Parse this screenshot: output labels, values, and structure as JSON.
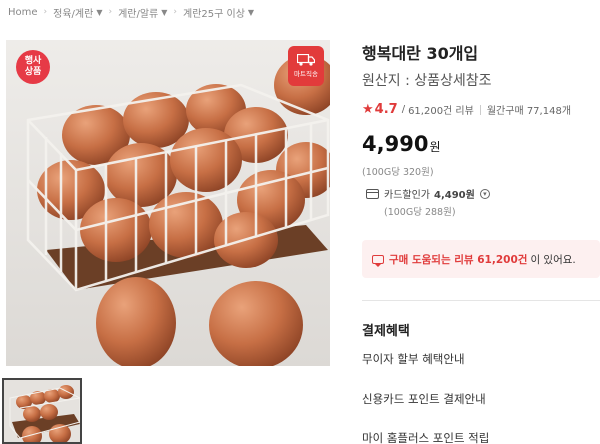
{
  "breadcrumb": {
    "home": "Home",
    "items": [
      "정육/계란",
      "계란/알류",
      "계란25구 이상"
    ]
  },
  "badges": {
    "event_line1": "행사",
    "event_line2": "상품",
    "mart_label": "마트직송"
  },
  "product": {
    "title": "행복대란 30개입",
    "origin": "원산지 : 상품상세참조",
    "rating": "4.7",
    "reviews": "61,200건 리뷰",
    "monthly": "월간구매 77,148개",
    "price": "4,990",
    "price_unit": "원",
    "unit_price": "(100G당 320원)",
    "card_label": "카드할인가",
    "card_price": "4,490원",
    "card_unit_price": "(100G당 288원)"
  },
  "review_banner": {
    "highlight": "구매 도움되는 리뷰 61,200건",
    "suffix": "이 있어요."
  },
  "benefits": {
    "title": "결제혜택",
    "items": [
      "무이자 할부 혜택안내",
      "신용카드 포인트 결제안내",
      "마이 홈플러스 포인트 적립"
    ]
  },
  "colors": {
    "accent": "#e03b3b",
    "banner_bg": "#fdf0f0"
  }
}
